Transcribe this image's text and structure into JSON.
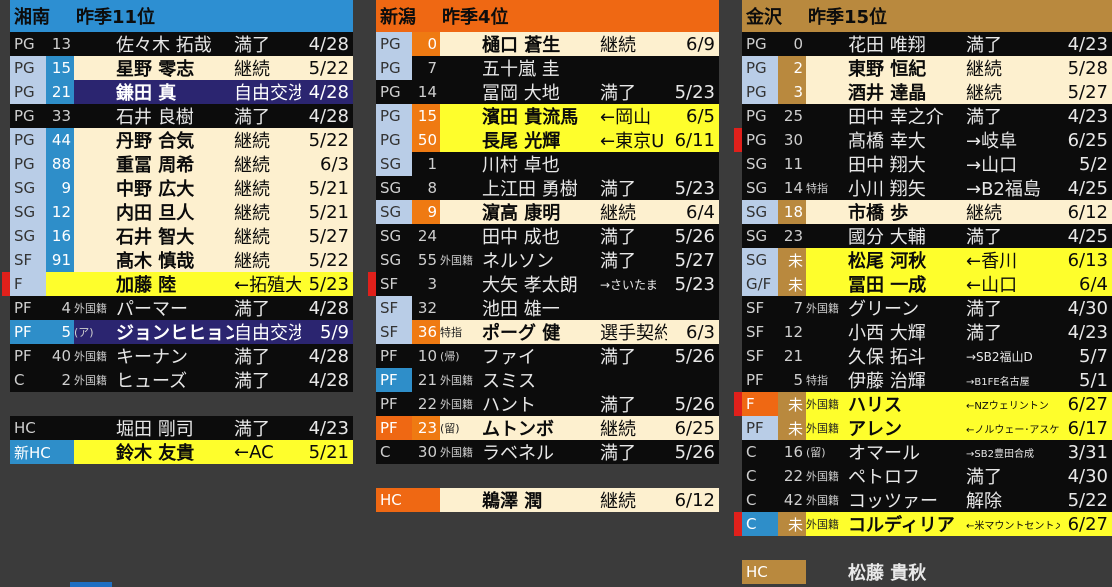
{
  "teams": [
    {
      "id": "shonan",
      "name": "湘南",
      "rank": "昨季11位",
      "header_color": "#2d8fd2",
      "rows": [
        {
          "pos": "PG",
          "num": "13",
          "tag": "",
          "player": "佐々木 拓哉",
          "status": "満了",
          "date": "4/28",
          "style": "black"
        },
        {
          "pos": "PG",
          "num": "15",
          "tag": "",
          "player": "星野 零志",
          "status": "継続",
          "date": "5/22",
          "style": "cream",
          "numcolor": "blue"
        },
        {
          "pos": "PG",
          "num": "21",
          "tag": "",
          "player": "鎌田 真",
          "status": "自由交渉",
          "date": "4/28",
          "style": "purple",
          "numcolor": "blue"
        },
        {
          "pos": "PG",
          "num": "33",
          "tag": "",
          "player": "石井 良樹",
          "status": "満了",
          "date": "4/28",
          "style": "black"
        },
        {
          "pos": "PG",
          "num": "44",
          "tag": "",
          "player": "丹野 合気",
          "status": "継続",
          "date": "5/22",
          "style": "cream",
          "numcolor": "blue"
        },
        {
          "pos": "PG",
          "num": "88",
          "tag": "",
          "player": "重冨 周希",
          "status": "継続",
          "date": "6/3",
          "style": "cream",
          "numcolor": "blue"
        },
        {
          "pos": "SG",
          "num": "9",
          "tag": "",
          "player": "中野 広大",
          "status": "継続",
          "date": "5/21",
          "style": "cream",
          "numcolor": "blue"
        },
        {
          "pos": "SG",
          "num": "12",
          "tag": "",
          "player": "内田 旦人",
          "status": "継続",
          "date": "5/21",
          "style": "cream",
          "numcolor": "blue"
        },
        {
          "pos": "SG",
          "num": "16",
          "tag": "",
          "player": "石井 智大",
          "status": "継続",
          "date": "5/27",
          "style": "cream",
          "numcolor": "blue"
        },
        {
          "pos": "SF",
          "num": "91",
          "tag": "",
          "player": "髙木 慎哉",
          "status": "継続",
          "date": "5/22",
          "style": "cream",
          "numcolor": "blue"
        },
        {
          "pos": "F",
          "num": "",
          "tag": "",
          "player": "加藤 陸",
          "status": "←拓殖大",
          "date": "5/23",
          "style": "yellow",
          "marker": true
        },
        {
          "pos": "PF",
          "num": "4",
          "tag": "外国籍",
          "player": "パーマー",
          "status": "満了",
          "date": "4/28",
          "style": "black"
        },
        {
          "pos": "PF",
          "num": "5",
          "tag": "(ア)",
          "player": "ジョンヒヒョン",
          "status": "自由交渉",
          "date": "5/9",
          "style": "purple",
          "numcolor": "blue",
          "posblue": true
        },
        {
          "pos": "PF",
          "num": "40",
          "tag": "外国籍",
          "player": "キーナン",
          "status": "満了",
          "date": "4/28",
          "style": "black"
        },
        {
          "pos": "C",
          "num": "2",
          "tag": "外国籍",
          "player": "ヒューズ",
          "status": "満了",
          "date": "4/28",
          "style": "black"
        },
        {
          "gap": true
        },
        {
          "pos": "HC",
          "num": "",
          "tag": "",
          "player": "堀田 剛司",
          "status": "満了",
          "date": "4/23",
          "style": "black",
          "hc": true
        },
        {
          "pos": "新HC",
          "num": "",
          "tag": "",
          "player": "鈴木 友貴",
          "status": "←AC",
          "date": "5/21",
          "style": "yellow",
          "hc": true,
          "posblue": true
        }
      ]
    },
    {
      "id": "niigata",
      "name": "新潟",
      "rank": "昨季4位",
      "header_color": "#ef6813",
      "rows": [
        {
          "pos": "PG",
          "num": "0",
          "tag": "",
          "player": "樋口 蒼生",
          "status": "継続",
          "date": "6/9",
          "style": "cream",
          "numcolor": "orange"
        },
        {
          "pos": "PG",
          "num": "7",
          "tag": "",
          "player": "五十嵐 圭",
          "status": "",
          "date": "",
          "style": "black",
          "numcolor": "orange",
          "poslb": true
        },
        {
          "pos": "PG",
          "num": "14",
          "tag": "",
          "player": "冨岡 大地",
          "status": "満了",
          "date": "5/23",
          "style": "black"
        },
        {
          "pos": "PG",
          "num": "15",
          "tag": "",
          "player": "濱田 貴流馬",
          "status": "←岡山",
          "date": "6/5",
          "style": "yellow",
          "numcolor": "orange"
        },
        {
          "pos": "PG",
          "num": "50",
          "tag": "",
          "player": "長尾 光輝",
          "status": "←東京U",
          "date": "6/11",
          "style": "yellow",
          "numcolor": "orange"
        },
        {
          "pos": "SG",
          "num": "1",
          "tag": "",
          "player": "川村 卓也",
          "status": "",
          "date": "",
          "style": "black",
          "numcolor": "orange",
          "poslb": true
        },
        {
          "pos": "SG",
          "num": "8",
          "tag": "",
          "player": "上江田 勇樹",
          "status": "満了",
          "date": "5/23",
          "style": "black"
        },
        {
          "pos": "SG",
          "num": "9",
          "tag": "",
          "player": "濵高 康明",
          "status": "継続",
          "date": "6/4",
          "style": "cream",
          "numcolor": "orange"
        },
        {
          "pos": "SG",
          "num": "24",
          "tag": "",
          "player": "田中 成也",
          "status": "満了",
          "date": "5/26",
          "style": "black"
        },
        {
          "pos": "SG",
          "num": "55",
          "tag": "外国籍",
          "player": "ネルソン",
          "status": "満了",
          "date": "5/27",
          "style": "black"
        },
        {
          "pos": "SF",
          "num": "3",
          "tag": "",
          "player": "大矢 孝太朗",
          "status": "→さいたま",
          "date": "5/23",
          "style": "black",
          "marker": true,
          "small": true
        },
        {
          "pos": "SF",
          "num": "32",
          "tag": "",
          "player": "池田 雄一",
          "status": "",
          "date": "",
          "style": "black",
          "numcolor": "orange",
          "poslb": true
        },
        {
          "pos": "SF",
          "num": "36",
          "tag": "特指",
          "player": "ポーグ 健",
          "status": "選手契約",
          "date": "6/3",
          "style": "cream",
          "numcolor": "orange"
        },
        {
          "pos": "PF",
          "num": "10",
          "tag": "(帰)",
          "player": "ファイ",
          "status": "満了",
          "date": "5/26",
          "style": "black"
        },
        {
          "pos": "PF",
          "num": "21",
          "tag": "外国籍",
          "player": "スミス",
          "status": "",
          "date": "",
          "style": "black",
          "numcolor": "orange",
          "posblue": true
        },
        {
          "pos": "PF",
          "num": "22",
          "tag": "外国籍",
          "player": "ハント",
          "status": "満了",
          "date": "5/26",
          "style": "black"
        },
        {
          "pos": "PF",
          "num": "23",
          "tag": "(留)",
          "player": "ムトンボ",
          "status": "継続",
          "date": "6/25",
          "style": "cream",
          "numcolor": "orange",
          "posorange": true
        },
        {
          "pos": "C",
          "num": "30",
          "tag": "外国籍",
          "player": "ラベネル",
          "status": "満了",
          "date": "5/26",
          "style": "black"
        },
        {
          "gap": true
        },
        {
          "pos": "HC",
          "num": "",
          "tag": "",
          "player": "鵜澤 潤",
          "status": "継続",
          "date": "6/12",
          "style": "cream",
          "hc": true,
          "posorange": true
        }
      ]
    },
    {
      "id": "kanazawa",
      "name": "金沢",
      "rank": "昨季15位",
      "header_color": "#b9893e",
      "rows": [
        {
          "pos": "PG",
          "num": "0",
          "tag": "",
          "player": "花田 唯翔",
          "status": "満了",
          "date": "4/23",
          "style": "black"
        },
        {
          "pos": "PG",
          "num": "2",
          "tag": "",
          "player": "東野 恒紀",
          "status": "継続",
          "date": "5/28",
          "style": "cream",
          "numcolor": "gold"
        },
        {
          "pos": "PG",
          "num": "3",
          "tag": "",
          "player": "酒井 達晶",
          "status": "継続",
          "date": "5/27",
          "style": "cream",
          "numcolor": "gold"
        },
        {
          "pos": "PG",
          "num": "25",
          "tag": "",
          "player": "田中 幸之介",
          "status": "満了",
          "date": "4/23",
          "style": "black"
        },
        {
          "pos": "PG",
          "num": "30",
          "tag": "",
          "player": "髙橋 幸大",
          "status": "→岐阜",
          "date": "6/25",
          "style": "black",
          "marker": true
        },
        {
          "pos": "SG",
          "num": "11",
          "tag": "",
          "player": "田中 翔大",
          "status": "→山口",
          "date": "5/2",
          "style": "black"
        },
        {
          "pos": "SG",
          "num": "14",
          "tag": "特指",
          "player": "小川 翔矢",
          "status": "→B2福島",
          "date": "4/25",
          "style": "black"
        },
        {
          "pos": "SG",
          "num": "18",
          "tag": "",
          "player": "市橋 歩",
          "status": "継続",
          "date": "6/12",
          "style": "cream",
          "numcolor": "gold"
        },
        {
          "pos": "SG",
          "num": "23",
          "tag": "",
          "player": "國分 大輔",
          "status": "満了",
          "date": "4/25",
          "style": "black"
        },
        {
          "pos": "SG",
          "num": "未",
          "tag": "",
          "player": "松尾 河秋",
          "status": "←香川",
          "date": "6/13",
          "style": "yellow",
          "numcolor": "gold"
        },
        {
          "pos": "G/F",
          "num": "未",
          "tag": "",
          "player": "冨田 一成",
          "status": "←山口",
          "date": "6/4",
          "style": "yellow",
          "numcolor": "gold"
        },
        {
          "pos": "SF",
          "num": "7",
          "tag": "外国籍",
          "player": "グリーン",
          "status": "満了",
          "date": "4/30",
          "style": "black"
        },
        {
          "pos": "SF",
          "num": "12",
          "tag": "",
          "player": "小西 大輝",
          "status": "満了",
          "date": "4/23",
          "style": "black"
        },
        {
          "pos": "SF",
          "num": "21",
          "tag": "",
          "player": "久保 拓斗",
          "status": "→SB2福山D",
          "date": "5/7",
          "style": "black",
          "small": true
        },
        {
          "pos": "PF",
          "num": "5",
          "tag": "特指",
          "player": "伊藤 治輝",
          "status": "→B1FE名古屋",
          "date": "5/1",
          "style": "black",
          "tiny": true
        },
        {
          "pos": "F",
          "num": "未",
          "tag": "外国籍",
          "player": "ハリス",
          "status": "←NZウェリントン",
          "date": "6/27",
          "style": "yellow",
          "numcolor": "gold",
          "marker": true,
          "posorange": true,
          "tiny": true
        },
        {
          "pos": "PF",
          "num": "未",
          "tag": "外国籍",
          "player": "アレン",
          "status": "←ノルウェー･アスケー",
          "date": "6/17",
          "style": "yellow",
          "numcolor": "gold",
          "tiny": true
        },
        {
          "pos": "C",
          "num": "16",
          "tag": "(留)",
          "player": "オマール",
          "status": "→SB2豊田合成",
          "date": "3/31",
          "style": "black",
          "tiny": true
        },
        {
          "pos": "C",
          "num": "22",
          "tag": "外国籍",
          "player": "ペトロフ",
          "status": "満了",
          "date": "4/30",
          "style": "black"
        },
        {
          "pos": "C",
          "num": "42",
          "tag": "外国籍",
          "player": "コッツァー",
          "status": "解除",
          "date": "5/22",
          "style": "black"
        },
        {
          "pos": "C",
          "num": "未",
          "tag": "外国籍",
          "player": "コルディリア",
          "status": "←米マウントセントメリー大",
          "date": "6/27",
          "style": "yellow",
          "numcolor": "gold",
          "marker": true,
          "posblue": true,
          "tiny": true
        },
        {
          "gap": true
        },
        {
          "pos": "HC",
          "num": "",
          "tag": "",
          "player": "松藤 貴秋",
          "status": "",
          "date": "",
          "style": "dark",
          "hc": true,
          "posgold": true
        }
      ]
    }
  ]
}
